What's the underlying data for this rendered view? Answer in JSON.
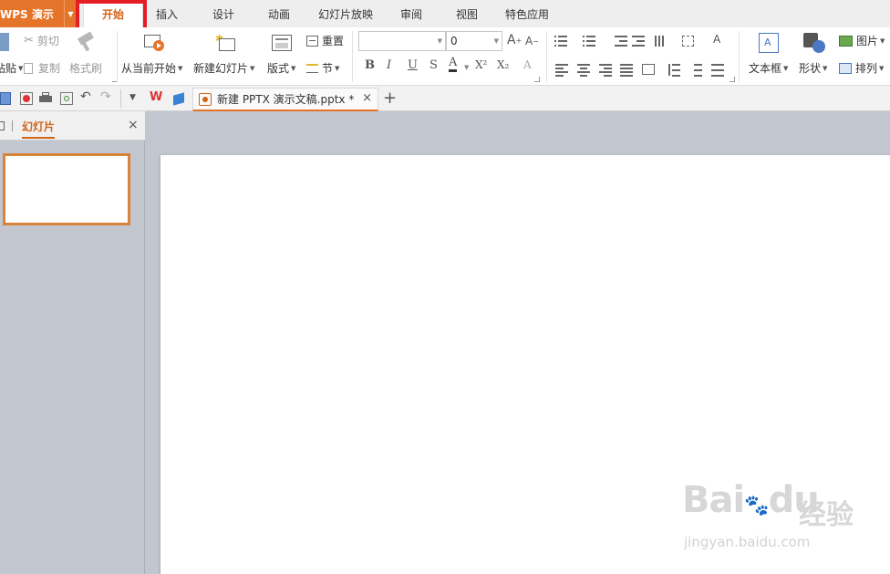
{
  "app": {
    "name": "WPS 演示",
    "accent_color": "#e5742b"
  },
  "menu_tabs": [
    {
      "label": "开始",
      "active": true
    },
    {
      "label": "插入"
    },
    {
      "label": "设计"
    },
    {
      "label": "动画"
    },
    {
      "label": "幻灯片放映"
    },
    {
      "label": "审阅"
    },
    {
      "label": "视图"
    },
    {
      "label": "特色应用"
    }
  ],
  "ribbon": {
    "clipboard": {
      "paste": "粘贴",
      "cut": "剪切",
      "copy": "复制",
      "format_painter": "格式刷"
    },
    "slides": {
      "from_current": "从当前开始",
      "new_slide": "新建幻灯片",
      "layout": "版式",
      "reset": "重置",
      "section": "节"
    },
    "font": {
      "font_name": "",
      "font_size": "0",
      "bold": "B",
      "italic": "I",
      "underline": "U",
      "shadow": "S",
      "font_color": "A",
      "superscript": "X²",
      "subscript": "X₂"
    },
    "drawing": {
      "textbox": "文本框",
      "shape": "形状",
      "picture": "图片",
      "arrange": "排列"
    }
  },
  "document_tab": {
    "title": "新建 PPTX 演示文稿.pptx *",
    "close": "×",
    "new_tab": "+"
  },
  "left_panel": {
    "tab": "幻灯片",
    "close": "×"
  },
  "watermark": {
    "brand": "Bai",
    "brand2": "du",
    "cn": "经验",
    "url": "jingyan.baidu.com"
  }
}
